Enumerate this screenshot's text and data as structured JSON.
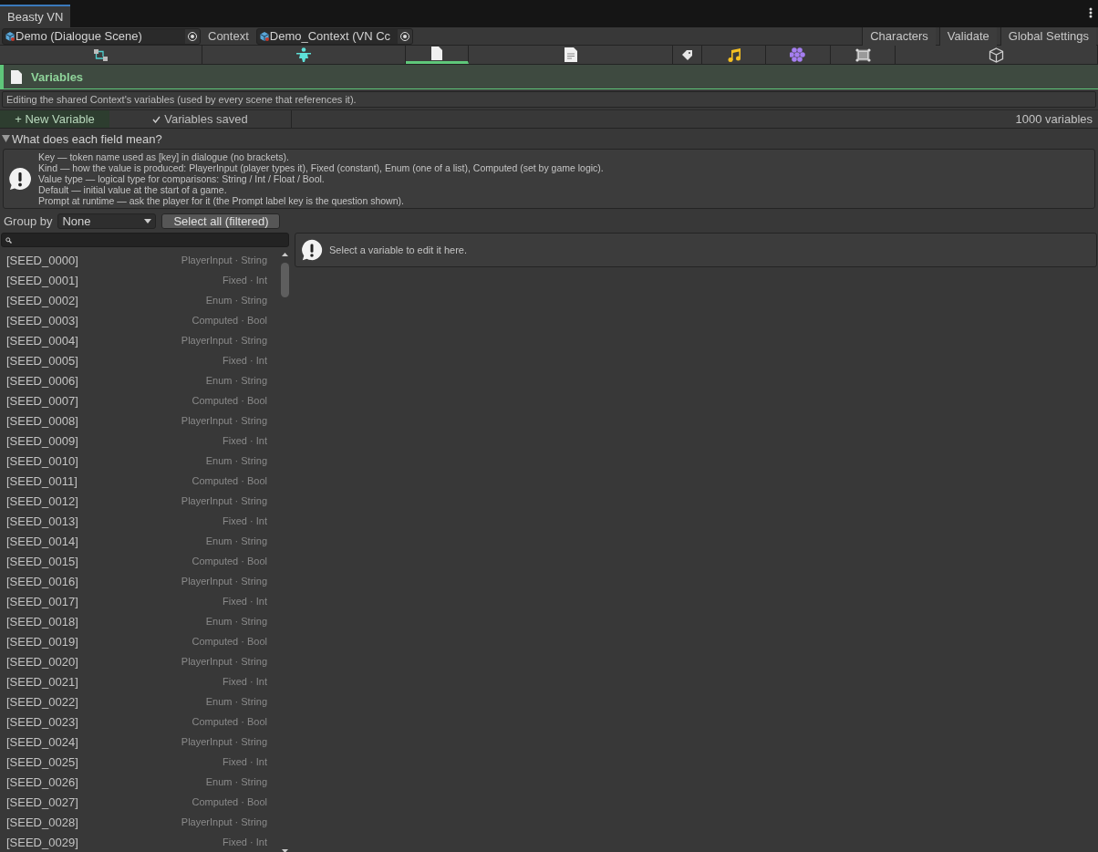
{
  "window": {
    "tab": "Beasty VN"
  },
  "object_bar": {
    "scene_field": "Demo (Dialogue Scene)",
    "context_label": "Context",
    "context_field": "Demo_Context (VN Cc",
    "buttons": [
      "Characters",
      "Validate",
      "Global Settings"
    ]
  },
  "tool_tabs": [
    {
      "kind": "graph",
      "selected": false
    },
    {
      "kind": "figure",
      "selected": false
    },
    {
      "kind": "page",
      "selected": true
    },
    {
      "kind": "document",
      "selected": false
    },
    {
      "kind": "tag",
      "selected": false
    },
    {
      "kind": "music",
      "selected": false
    },
    {
      "kind": "hexagons",
      "selected": false
    },
    {
      "kind": "frame",
      "selected": false
    },
    {
      "kind": "cube",
      "selected": false
    }
  ],
  "header": {
    "title": "Variables"
  },
  "notice": "Editing the shared Context's variables (used by every scene that references it).",
  "toolbar": {
    "new_button": "+ New Variable",
    "status": "Variables saved",
    "count": "1000 variables"
  },
  "foldout": {
    "title": "What does each field mean?",
    "expanded": true,
    "lines": [
      "Key — token name used as [key] in dialogue (no brackets).",
      "Kind — how the value is produced: PlayerInput (player types it), Fixed (constant), Enum (one of a list), Computed (set by game logic).",
      "Value type — logical type for comparisons: String / Int / Float / Bool.",
      "Default — initial value at the start of a game.",
      "Prompt at runtime — ask the player for it (the Prompt label key is the question shown)."
    ]
  },
  "group_by": {
    "label": "Group by",
    "value": "None",
    "select_all": "Select all (filtered)"
  },
  "variables": [
    {
      "key": "[SEED_0000]",
      "info": "PlayerInput · String"
    },
    {
      "key": "[SEED_0001]",
      "info": "Fixed · Int"
    },
    {
      "key": "[SEED_0002]",
      "info": "Enum · String"
    },
    {
      "key": "[SEED_0003]",
      "info": "Computed · Bool"
    },
    {
      "key": "[SEED_0004]",
      "info": "PlayerInput · String"
    },
    {
      "key": "[SEED_0005]",
      "info": "Fixed · Int"
    },
    {
      "key": "[SEED_0006]",
      "info": "Enum · String"
    },
    {
      "key": "[SEED_0007]",
      "info": "Computed · Bool"
    },
    {
      "key": "[SEED_0008]",
      "info": "PlayerInput · String"
    },
    {
      "key": "[SEED_0009]",
      "info": "Fixed · Int"
    },
    {
      "key": "[SEED_0010]",
      "info": "Enum · String"
    },
    {
      "key": "[SEED_0011]",
      "info": "Computed · Bool"
    },
    {
      "key": "[SEED_0012]",
      "info": "PlayerInput · String"
    },
    {
      "key": "[SEED_0013]",
      "info": "Fixed · Int"
    },
    {
      "key": "[SEED_0014]",
      "info": "Enum · String"
    },
    {
      "key": "[SEED_0015]",
      "info": "Computed · Bool"
    },
    {
      "key": "[SEED_0016]",
      "info": "PlayerInput · String"
    },
    {
      "key": "[SEED_0017]",
      "info": "Fixed · Int"
    },
    {
      "key": "[SEED_0018]",
      "info": "Enum · String"
    },
    {
      "key": "[SEED_0019]",
      "info": "Computed · Bool"
    },
    {
      "key": "[SEED_0020]",
      "info": "PlayerInput · String"
    },
    {
      "key": "[SEED_0021]",
      "info": "Fixed · Int"
    },
    {
      "key": "[SEED_0022]",
      "info": "Enum · String"
    },
    {
      "key": "[SEED_0023]",
      "info": "Computed · Bool"
    },
    {
      "key": "[SEED_0024]",
      "info": "PlayerInput · String"
    },
    {
      "key": "[SEED_0025]",
      "info": "Fixed · Int"
    },
    {
      "key": "[SEED_0026]",
      "info": "Enum · String"
    },
    {
      "key": "[SEED_0027]",
      "info": "Computed · Bool"
    },
    {
      "key": "[SEED_0028]",
      "info": "PlayerInput · String"
    },
    {
      "key": "[SEED_0029]",
      "info": "Fixed · Int"
    }
  ],
  "detail": {
    "message": "Select a variable to edit it here."
  }
}
